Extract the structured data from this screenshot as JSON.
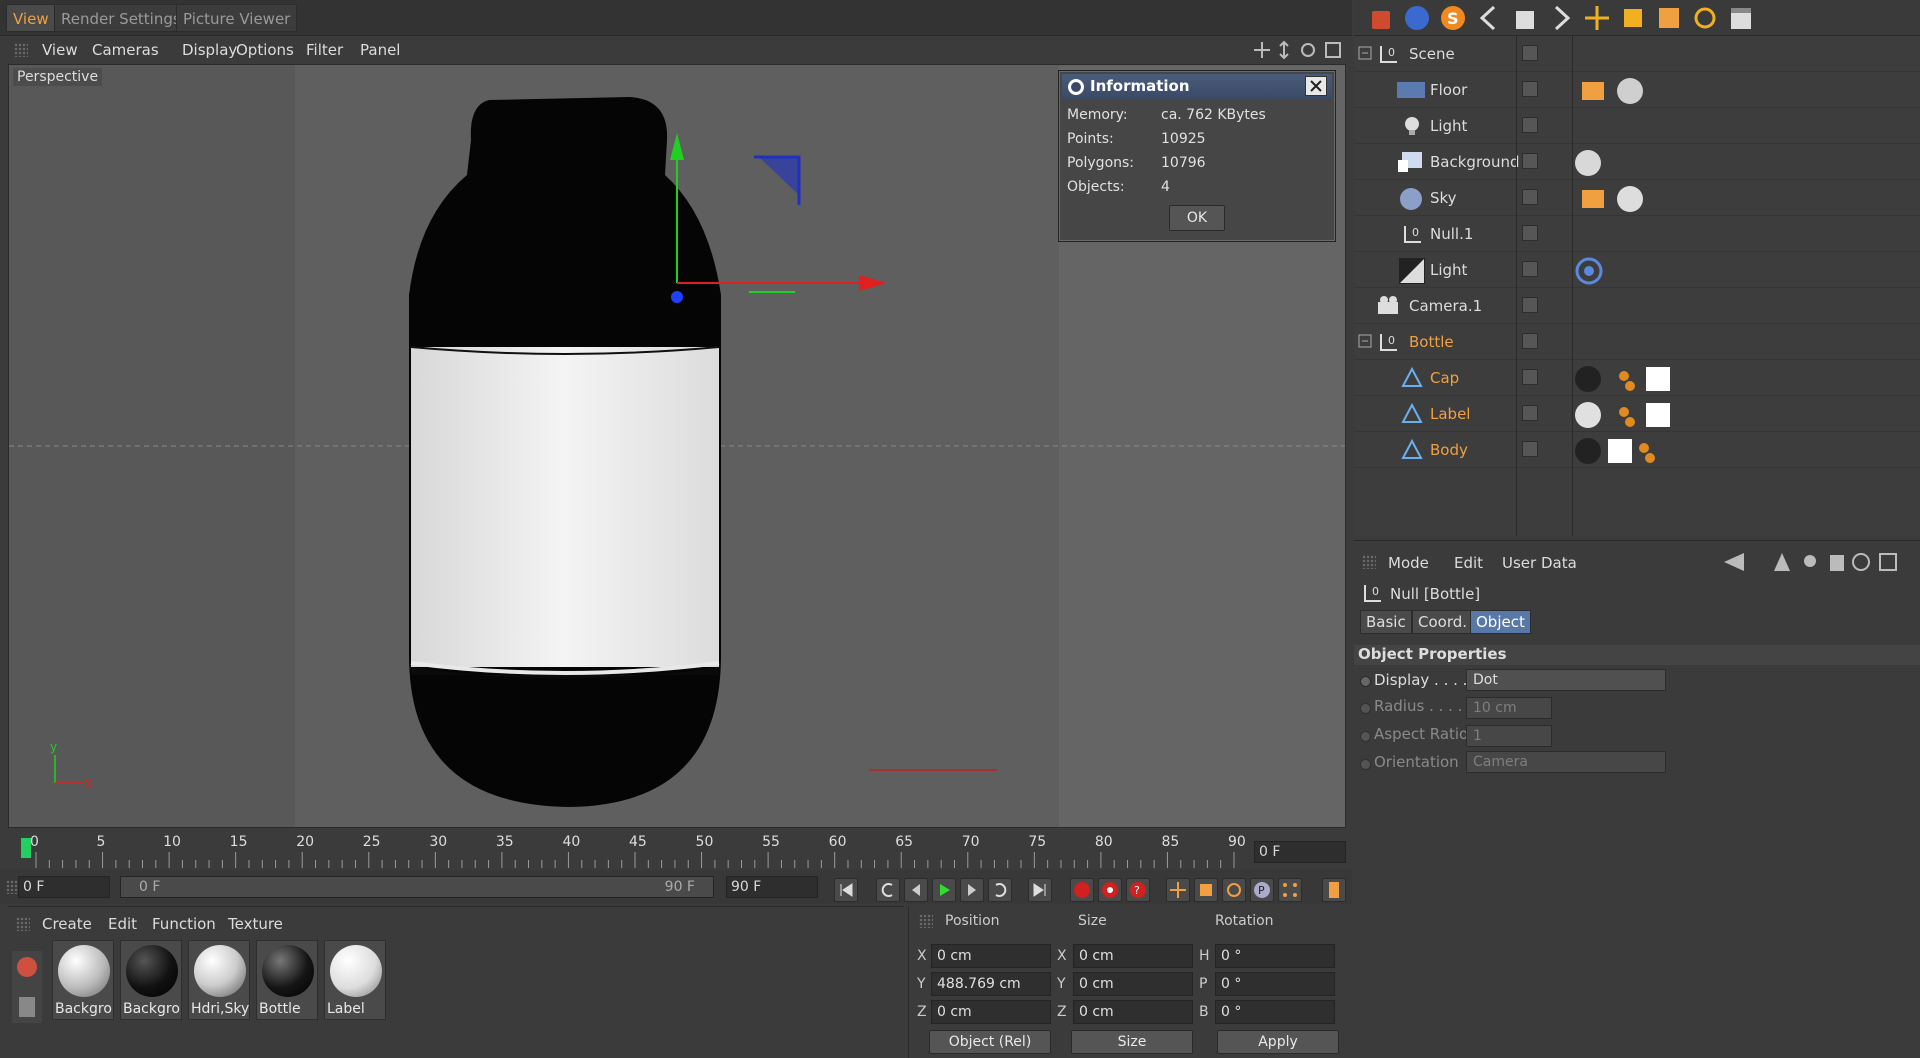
{
  "top_tabs": [
    "View",
    "Render Settings",
    "Picture Viewer"
  ],
  "viewport_menu": [
    "View",
    "Cameras",
    "Display",
    "Options",
    "Filter",
    "Panel"
  ],
  "viewport": {
    "label": "Perspective",
    "axis_x": "x",
    "axis_y": "y"
  },
  "info_dialog": {
    "title": "Information",
    "rows": [
      {
        "label": "Memory:",
        "value": "ca. 762 KBytes"
      },
      {
        "label": "Points:",
        "value": "10925"
      },
      {
        "label": "Polygons:",
        "value": "10796"
      },
      {
        "label": "Objects:",
        "value": "4"
      }
    ],
    "ok_label": "OK"
  },
  "timeline": {
    "ticks": [
      "0",
      "5",
      "10",
      "15",
      "20",
      "25",
      "30",
      "35",
      "40",
      "45",
      "50",
      "55",
      "60",
      "65",
      "70",
      "75",
      "80",
      "85",
      "90"
    ],
    "current_frame": "0 F",
    "start_frame": "0 F",
    "range_start": "0 F",
    "range_end": "90 F",
    "end_frame": "90 F"
  },
  "materials": {
    "menu": [
      "Create",
      "Edit",
      "Function",
      "Texture"
    ],
    "items": [
      {
        "label": "Backgrou"
      },
      {
        "label": "Backgrou"
      },
      {
        "label": "Hdri,Sky"
      },
      {
        "label": "Bottle"
      },
      {
        "label": "Label"
      }
    ]
  },
  "coordinates": {
    "headers": [
      "Position",
      "Size",
      "Rotation"
    ],
    "rows": [
      {
        "axis": "X",
        "pos": "0 cm",
        "size_axis": "X",
        "size": "0 cm",
        "rot_axis": "H",
        "rot": "0 °"
      },
      {
        "axis": "Y",
        "pos": "488.769 cm",
        "size_axis": "Y",
        "size": "0 cm",
        "rot_axis": "P",
        "rot": "0 °"
      },
      {
        "axis": "Z",
        "pos": "0 cm",
        "size_axis": "Z",
        "size": "0 cm",
        "rot_axis": "B",
        "rot": "0 °"
      }
    ],
    "mode_select": "Object (Rel)",
    "size_select": "Size",
    "apply_label": "Apply"
  },
  "objects": [
    {
      "name": "Scene",
      "selected": false
    },
    {
      "name": "Floor",
      "selected": false
    },
    {
      "name": "Light",
      "selected": false
    },
    {
      "name": "Background",
      "selected": false
    },
    {
      "name": "Sky",
      "selected": false
    },
    {
      "name": "Null.1",
      "selected": false
    },
    {
      "name": "Light",
      "selected": false
    },
    {
      "name": "Camera.1",
      "selected": false
    },
    {
      "name": "Bottle",
      "selected": true
    },
    {
      "name": "Cap",
      "selected": true
    },
    {
      "name": "Label",
      "selected": true
    },
    {
      "name": "Body",
      "selected": true
    }
  ],
  "attributes": {
    "menu": [
      "Mode",
      "Edit",
      "User Data"
    ],
    "object_title": "Null [Bottle]",
    "tabs": [
      "Basic",
      "Coord.",
      "Object"
    ],
    "section": "Object Properties",
    "props": [
      {
        "label": "Display . . . .",
        "value": "Dot"
      },
      {
        "label": "Radius . . . . .",
        "value": "10 cm"
      },
      {
        "label": "Aspect Ratio",
        "value": "1"
      },
      {
        "label": "Orientation",
        "value": "Camera"
      }
    ]
  },
  "colors": {
    "accent": "#f0a040",
    "active_tab": "#5878a8",
    "x_axis": "#e02020",
    "y_axis": "#20d020",
    "z_axis": "#2040ff"
  }
}
